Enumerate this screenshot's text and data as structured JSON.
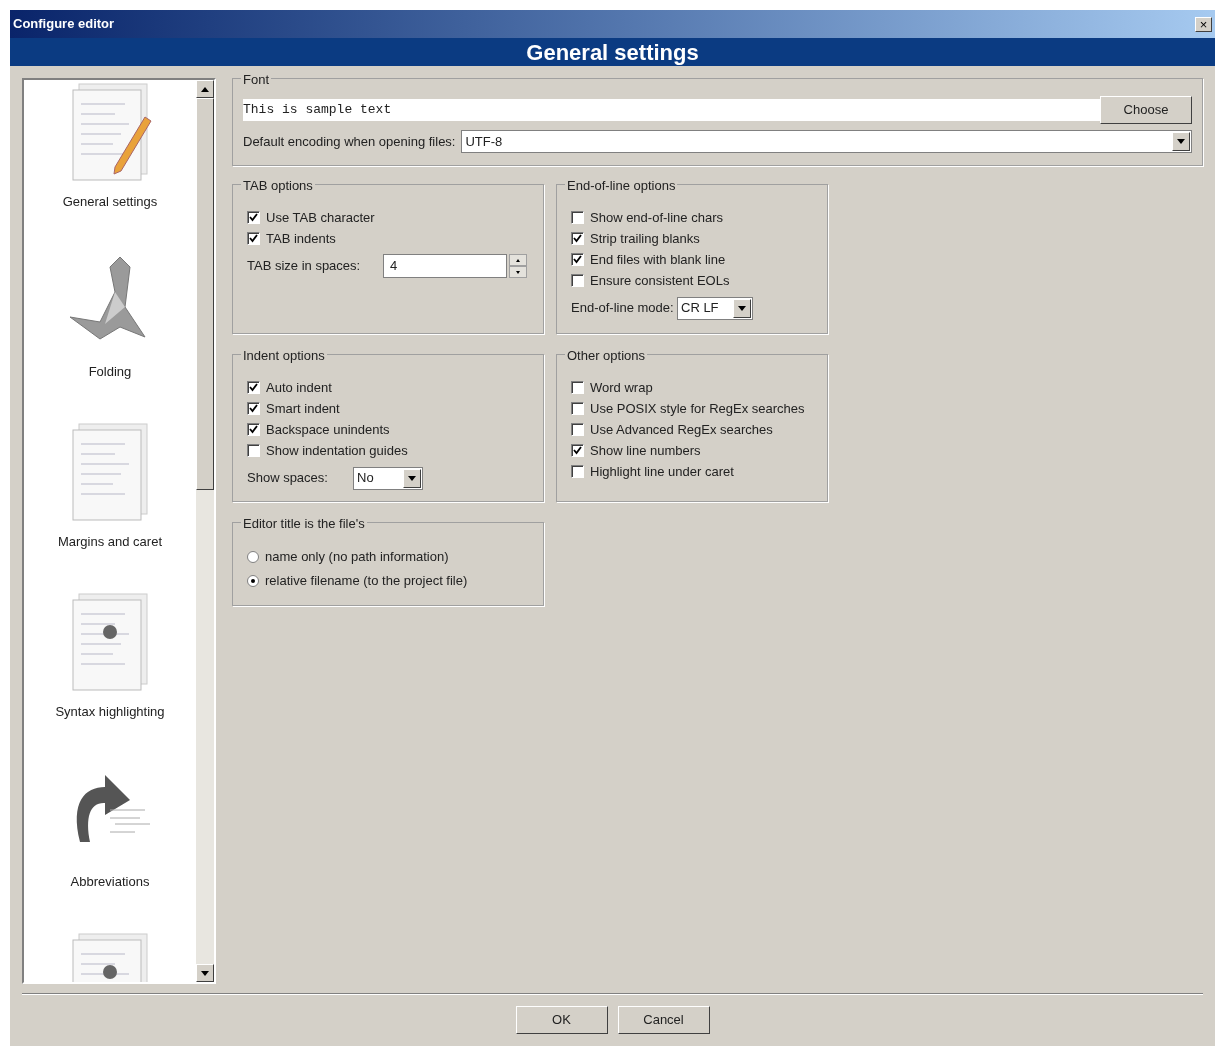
{
  "window": {
    "title": "Configure editor",
    "close": "×"
  },
  "header": {
    "title": "General settings"
  },
  "sidebar": {
    "items": [
      {
        "label": "General settings"
      },
      {
        "label": "Folding"
      },
      {
        "label": "Margins and caret"
      },
      {
        "label": "Syntax highlighting"
      },
      {
        "label": "Abbreviations"
      }
    ]
  },
  "font_group": {
    "title": "Font",
    "sample": "This is sample text",
    "choose_button": "Choose",
    "encoding_label": "Default encoding when opening files:",
    "encoding_value": "UTF-8"
  },
  "groups": [
    {
      "title": "TAB options",
      "items": [
        {
          "kind": "checkbox",
          "label": "Use TAB character",
          "checked": true
        },
        {
          "kind": "checkbox",
          "label": "TAB indents",
          "checked": true
        },
        {
          "kind": "spin",
          "label": "TAB size in spaces:",
          "value": "4"
        }
      ]
    },
    {
      "title": "End-of-line options",
      "items": [
        {
          "kind": "checkbox",
          "label": "Show end-of-line chars",
          "checked": false
        },
        {
          "kind": "checkbox",
          "label": "Strip trailing blanks",
          "checked": true
        },
        {
          "kind": "checkbox",
          "label": "End files with blank line",
          "checked": true
        },
        {
          "kind": "checkbox",
          "label": "Ensure consistent EOLs",
          "checked": false
        },
        {
          "kind": "select",
          "label": "End-of-line mode:",
          "value": "CR LF"
        }
      ]
    },
    {
      "title": "Indent options",
      "items": [
        {
          "kind": "checkbox",
          "label": "Auto indent",
          "checked": true
        },
        {
          "kind": "checkbox",
          "label": "Smart indent",
          "checked": true
        },
        {
          "kind": "checkbox",
          "label": "Backspace unindents",
          "checked": true
        },
        {
          "kind": "checkbox",
          "label": "Show indentation guides",
          "checked": false
        },
        {
          "kind": "select",
          "label": "Show spaces:",
          "value": "No"
        }
      ]
    },
    {
      "title": "Other options",
      "items": [
        {
          "kind": "checkbox",
          "label": "Word wrap",
          "checked": false
        },
        {
          "kind": "checkbox",
          "label": "Use POSIX style for RegEx searches",
          "checked": false
        },
        {
          "kind": "checkbox",
          "label": "Use Advanced RegEx searches",
          "checked": false
        },
        {
          "kind": "checkbox",
          "label": "Show line numbers",
          "checked": true
        },
        {
          "kind": "checkbox",
          "label": "Highlight line under caret",
          "checked": false
        }
      ]
    },
    {
      "title": "Editor title is the file's",
      "items": [
        {
          "kind": "radio",
          "label": "name only (no path information)",
          "selected": false
        },
        {
          "kind": "radio",
          "label": "relative filename (to the project file)",
          "selected": true
        }
      ]
    }
  ],
  "buttons": [
    "OK",
    "Cancel"
  ]
}
